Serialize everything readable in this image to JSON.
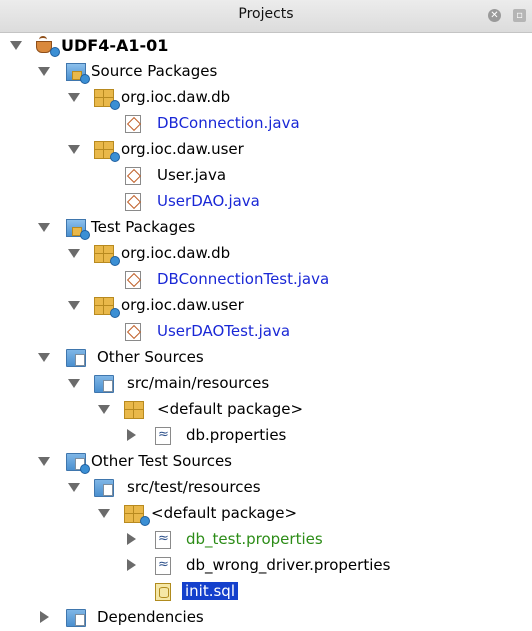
{
  "panel": {
    "title": "Projects",
    "close_label": "✕",
    "max_label": "▫"
  },
  "tree": [
    {
      "label": "UDF4-A1-01",
      "type": "project",
      "expanded": true
    },
    {
      "label": "Source Packages",
      "type": "source-packages",
      "expanded": true
    },
    {
      "label": "org.ioc.daw.db",
      "type": "package",
      "expanded": true
    },
    {
      "label": "DBConnection.java",
      "type": "java-file",
      "status": "modified"
    },
    {
      "label": "org.ioc.daw.user",
      "type": "package",
      "expanded": true
    },
    {
      "label": "User.java",
      "type": "java-file",
      "status": "normal"
    },
    {
      "label": "UserDAO.java",
      "type": "java-file",
      "status": "modified"
    },
    {
      "label": "Test Packages",
      "type": "test-packages",
      "expanded": true
    },
    {
      "label": "org.ioc.daw.db",
      "type": "package",
      "expanded": true
    },
    {
      "label": "DBConnectionTest.java",
      "type": "java-file",
      "status": "modified"
    },
    {
      "label": "org.ioc.daw.user",
      "type": "package",
      "expanded": true
    },
    {
      "label": "UserDAOTest.java",
      "type": "java-file",
      "status": "modified"
    },
    {
      "label": "Other Sources",
      "type": "folder",
      "expanded": true
    },
    {
      "label": "src/main/resources",
      "type": "folder",
      "expanded": true
    },
    {
      "label": "<default package>",
      "type": "package",
      "expanded": true
    },
    {
      "label": "db.properties",
      "type": "properties-file",
      "expanded": false
    },
    {
      "label": "Other Test Sources",
      "type": "folder",
      "expanded": true
    },
    {
      "label": "src/test/resources",
      "type": "folder",
      "expanded": true
    },
    {
      "label": "<default package>",
      "type": "package",
      "expanded": true
    },
    {
      "label": "db_test.properties",
      "type": "properties-file",
      "status": "new",
      "expanded": false
    },
    {
      "label": "db_wrong_driver.properties",
      "type": "properties-file",
      "expanded": false
    },
    {
      "label": "init.sql",
      "type": "sql-file",
      "selected": true
    },
    {
      "label": "Dependencies",
      "type": "folder",
      "expanded": false
    }
  ],
  "colors": {
    "modified": "#1a28d6",
    "new": "#2c8c17",
    "selection": "#1440cc"
  }
}
